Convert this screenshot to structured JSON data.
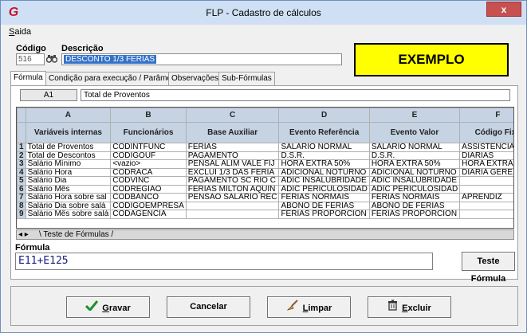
{
  "window": {
    "title": "FLP - Cadastro de cálculos",
    "close_glyph": "x",
    "app_icon": "G"
  },
  "menu": {
    "saida_first": "S",
    "saida_rest": "aida"
  },
  "form": {
    "codigo_label": "Código",
    "codigo_value": "516",
    "descricao_label": "Descrição",
    "descricao_value": "DESCONTO 1/3 FERIAS"
  },
  "banner": "EXEMPLO",
  "tabs": [
    {
      "label": "Fórmula"
    },
    {
      "label": "Condição para execução / Parâmetros"
    },
    {
      "label": "Observações"
    },
    {
      "label": "Sub-Fórmulas"
    }
  ],
  "cell": {
    "ref": "A1",
    "value": "Total de Proventos"
  },
  "grid": {
    "col_letters": [
      "A",
      "B",
      "C",
      "D",
      "E",
      "F"
    ],
    "col_titles": [
      "Variáveis internas",
      "Funcionários",
      "Base Auxiliar",
      "Evento Referência",
      "Evento Valor",
      "Código Fixo"
    ],
    "rows": [
      [
        "1",
        "Total de Proventos",
        "CODINTFUNC",
        "FERIAS",
        "SALARIO NORMAL",
        "SALARIO NORMAL",
        "ASSISTENCIA MED"
      ],
      [
        "2",
        "Total de Descontos",
        "CODIGOUF",
        "PAGAMENTO",
        "D.S.R.",
        "D.S.R.",
        "DIARIAS"
      ],
      [
        "3",
        "Salário Mínimo",
        "<vazio>",
        "PENSAL ALIM VALE FIJ",
        "HORA EXTRA 50%",
        "HORA EXTRA 50%",
        "HORA EXTRA"
      ],
      [
        "4",
        "Salário Hora",
        "CODRACA",
        "EXCLUI 1/3 DAS FERIA",
        "ADICIONAL NOTURNO",
        "ADICIONAL NOTURNO",
        "DIARIA GERENCIA"
      ],
      [
        "5",
        "Salário Dia",
        "CODVINC",
        "PAGAMENTO SC RIO C",
        "ADIC INSALUBRIDADE",
        "ADIC INSALUBRIDADE",
        ""
      ],
      [
        "6",
        "Salário Mês",
        "CODREGIAO",
        "FERIAS MILTON AQUIN",
        "ADIC PERICULOSIDAD",
        "ADIC PERICULOSIDAD",
        ""
      ],
      [
        "7",
        "Salário Hora sobre sal",
        "CODBANCO",
        "PENSAO SALARIO REC",
        "FERIAS NORMAIS",
        "FERIAS NORMAIS",
        "APRENDIZ"
      ],
      [
        "8",
        "Salário Dia sobre salá",
        "CODIGOEMPRESA",
        "",
        "ABONO DE FERIAS",
        "ABONO DE FERIAS",
        ""
      ],
      [
        "9",
        "Salário Mês sobre salá",
        "CODAGENCIA",
        "",
        "FERIAS PROPORCION",
        "FERIAS PROPORCION",
        ""
      ]
    ]
  },
  "sheet": {
    "nav": "◂ ▸",
    "tab": "\\ Teste de Fórmulas /"
  },
  "formula": {
    "label": "Fórmula",
    "value": "E11+E125",
    "test_button": "Teste Fórmula"
  },
  "buttons": {
    "gravar_first": "G",
    "gravar_rest": "ravar",
    "cancelar": "Cancelar",
    "limpar_first": "L",
    "limpar_rest": "impar",
    "excluir_first": "E",
    "excluir_rest": "xcluir"
  }
}
